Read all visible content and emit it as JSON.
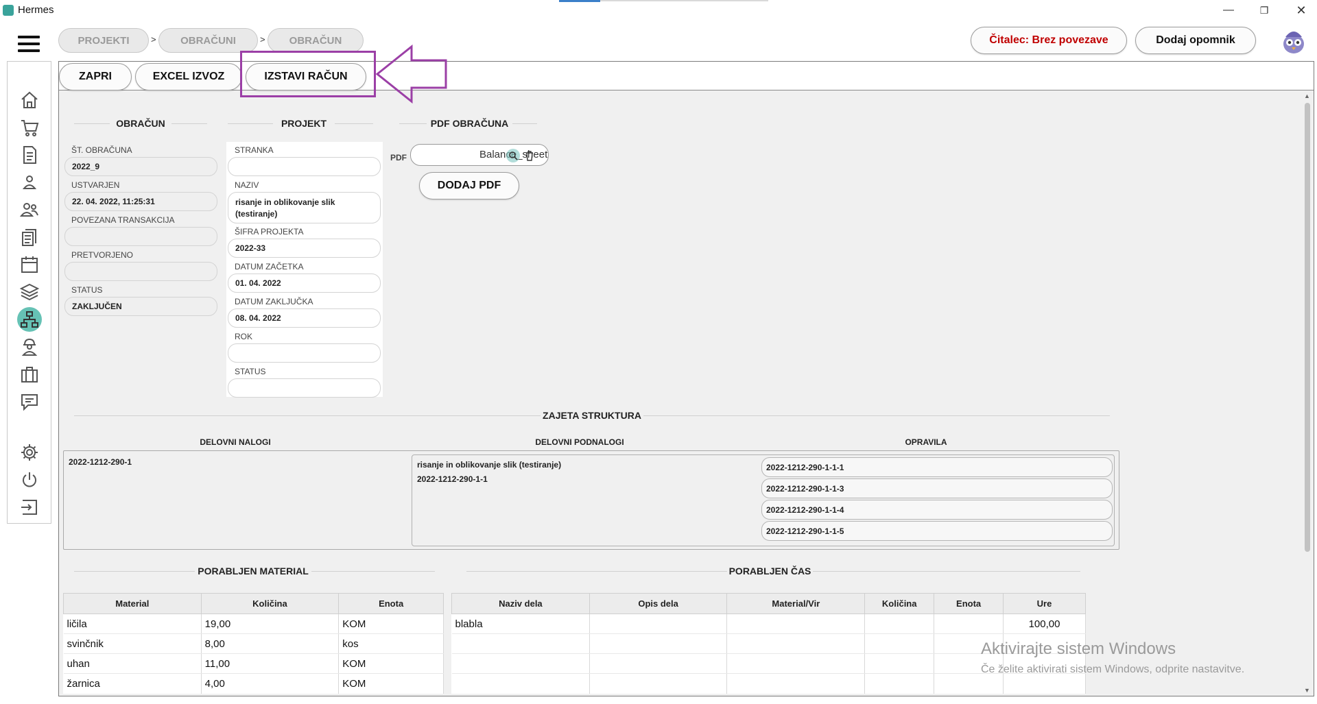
{
  "window": {
    "title": "Hermes",
    "minimize_glyph": "—",
    "restore_glyph": "❐",
    "close_glyph": "✕"
  },
  "breadcrumbs": [
    {
      "label": "PROJEKTI"
    },
    {
      "label": "OBRAČUNI"
    },
    {
      "label": "OBRAČUN"
    }
  ],
  "breadcrumb_separator": ">",
  "header": {
    "reader_status": "Čitalec: Brez povezave",
    "reader_status_color": "#c00000",
    "add_reminder": "Dodaj opomnik"
  },
  "sidebar": {
    "items": [
      {
        "icon": "home-icon"
      },
      {
        "icon": "cart-icon"
      },
      {
        "icon": "document-icon"
      },
      {
        "icon": "person-icon"
      },
      {
        "icon": "people-icon"
      },
      {
        "icon": "documents-icon"
      },
      {
        "icon": "calendar-icon"
      },
      {
        "icon": "layers-icon"
      },
      {
        "icon": "hierarchy-icon",
        "active": true
      },
      {
        "icon": "worker-icon"
      },
      {
        "icon": "briefcase-icon"
      },
      {
        "icon": "chat-icon"
      },
      {
        "icon": "gear-icon"
      },
      {
        "icon": "power-icon"
      },
      {
        "icon": "logout-icon"
      }
    ],
    "active_color": "#66c2b5"
  },
  "toolbar": {
    "close": "ZAPRI",
    "excel_export": "EXCEL IZVOZ",
    "issue_invoice": "IZSTAVI RAČUN"
  },
  "highlight_color": "#9b3fa6",
  "obracun": {
    "heading": "OBRAČUN",
    "number_label": "ŠT. OBRAČUNA",
    "number": "2022_9",
    "created_label": "USTVARJEN",
    "created": "22. 04. 2022, 11:25:31",
    "transaction_label": "POVEZANA TRANSAKCIJA",
    "transaction": "",
    "converted_label": "PRETVORJENO",
    "converted": "",
    "status_label": "STATUS",
    "status": "ZAKLJUČEN"
  },
  "projekt": {
    "heading": "PROJEKT",
    "client_label": "STRANKA",
    "client": "",
    "name_label": "NAZIV",
    "name_line1": "risanje in oblikovanje slik",
    "name_line2": "(testiranje)",
    "code_label": "ŠIFRA PROJEKTA",
    "code": "2022-33",
    "start_label": "DATUM ZAČETKA",
    "start": "01. 04. 2022",
    "end_label": "DATUM ZAKLJUČKA",
    "end": "08. 04. 2022",
    "deadline_label": "ROK",
    "deadline": "",
    "status_label": "STATUS",
    "status": ""
  },
  "pdf": {
    "heading": "PDF OBRAČUNA",
    "label": "PDF",
    "file": "Balance_sheet",
    "add_button": "DODAJ PDF"
  },
  "structure": {
    "heading": "ZAJETA STRUKTURA",
    "col_orders": "DELOVNI NALOGI",
    "col_suborders": "DELOVNI PODNALOGI",
    "col_tasks": "OPRAVILA",
    "order": "2022-1212-290-1",
    "suborder_name": "risanje in oblikovanje slik (testiranje)",
    "suborder_code": "2022-1212-290-1-1",
    "tasks": [
      "2022-1212-290-1-1-1",
      "2022-1212-290-1-1-3",
      "2022-1212-290-1-1-4",
      "2022-1212-290-1-1-5"
    ]
  },
  "material": {
    "heading": "PORABLJEN MATERIAL",
    "columns": [
      "Material",
      "Količina",
      "Enota"
    ],
    "rows": [
      [
        "ličila",
        "19,00",
        "KOM"
      ],
      [
        "svinčnik",
        "8,00",
        "kos"
      ],
      [
        "uhan",
        "11,00",
        "KOM"
      ],
      [
        "žarnica",
        "4,00",
        "KOM"
      ]
    ]
  },
  "time": {
    "heading": "PORABLJEN ČAS",
    "columns": [
      "Naziv dela",
      "Opis dela",
      "Material/Vir",
      "Količina",
      "Enota",
      "Ure"
    ],
    "rows": [
      [
        "blabla",
        "",
        "",
        "",
        "",
        "100,00"
      ],
      [
        "",
        "",
        "",
        "",
        "",
        ""
      ],
      [
        "",
        "",
        "",
        "",
        "",
        ""
      ],
      [
        "",
        "",
        "",
        "",
        "",
        ""
      ]
    ]
  },
  "watermark": {
    "title": "Aktivirajte sistem Windows",
    "subtitle": "Če želite aktivirati sistem Windows, odprite nastavitve."
  }
}
